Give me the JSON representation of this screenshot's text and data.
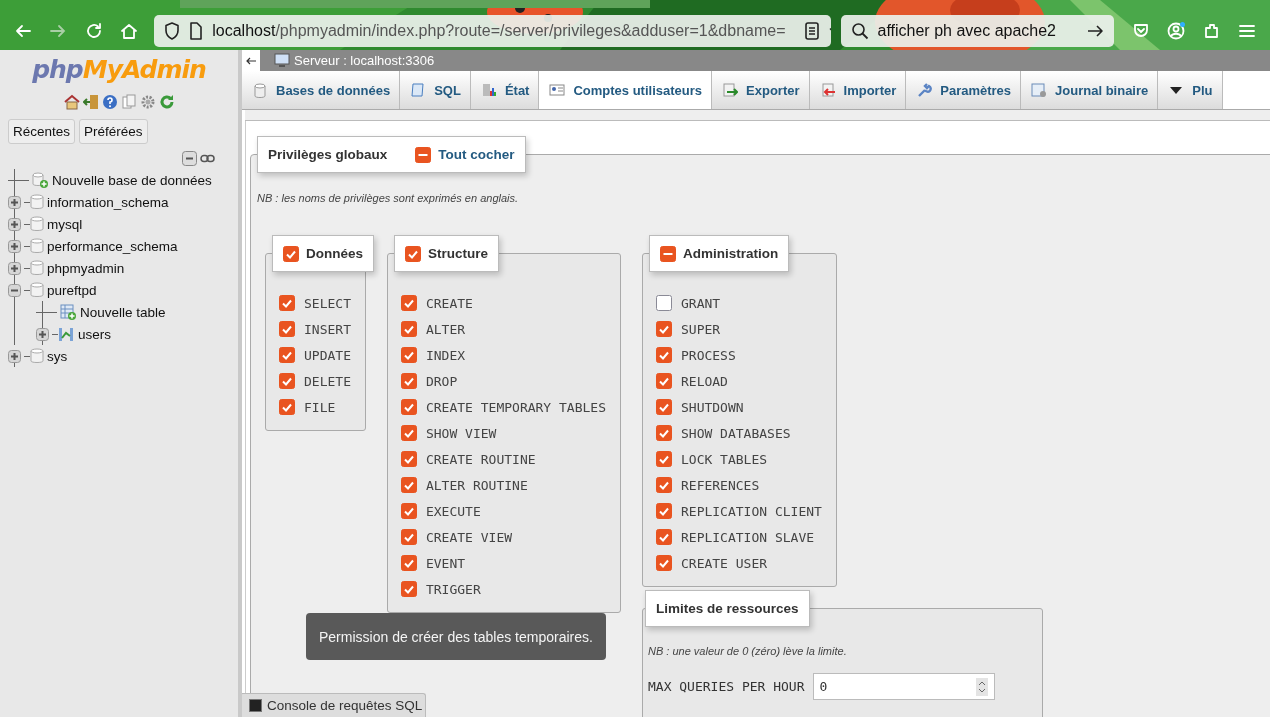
{
  "browser": {
    "url_host": "localhost",
    "url_path": "/phpmyadmin/index.php?route=/server/privileges&adduser=1&dbname=",
    "search": "afficher ph avec apache2"
  },
  "navigation": {
    "logo_php": "php",
    "logo_myadmin": "MyAdmin",
    "tabs": [
      {
        "label": "Récentes"
      },
      {
        "label": "Préférées"
      }
    ],
    "tree": [
      {
        "label": "Nouvelle base de données",
        "kind": "new-db"
      },
      {
        "label": "information_schema",
        "kind": "db",
        "expanded": false
      },
      {
        "label": "mysql",
        "kind": "db",
        "expanded": false
      },
      {
        "label": "performance_schema",
        "kind": "db",
        "expanded": false
      },
      {
        "label": "phpmyadmin",
        "kind": "db",
        "expanded": false
      },
      {
        "label": "pureftpd",
        "kind": "db",
        "expanded": true,
        "children": [
          {
            "label": "Nouvelle table",
            "kind": "new-table"
          },
          {
            "label": "users",
            "kind": "table",
            "expanded": false
          }
        ]
      },
      {
        "label": "sys",
        "kind": "db",
        "expanded": false
      }
    ]
  },
  "breadcrumb": "Serveur : localhost:3306",
  "tabs": [
    {
      "label": "Bases de données",
      "selected": false
    },
    {
      "label": "SQL",
      "selected": false
    },
    {
      "label": "État",
      "selected": false
    },
    {
      "label": "Comptes utilisateurs",
      "selected": true
    },
    {
      "label": "Exporter",
      "selected": false
    },
    {
      "label": "Importer",
      "selected": false
    },
    {
      "label": "Paramètres",
      "selected": false
    },
    {
      "label": "Journal binaire",
      "selected": false
    },
    {
      "label": "Plu",
      "selected": false
    }
  ],
  "global_privileges": {
    "title": "Privilèges globaux",
    "toggle_all": "Tout cocher",
    "toggle_indeterminate": true,
    "note": "NB : les noms de privilèges sont exprimés en anglais.",
    "groups": [
      {
        "title": "Données",
        "checked": true,
        "indeterminate": false,
        "items": [
          {
            "label": "SELECT",
            "checked": true
          },
          {
            "label": "INSERT",
            "checked": true
          },
          {
            "label": "UPDATE",
            "checked": true
          },
          {
            "label": "DELETE",
            "checked": true
          },
          {
            "label": "FILE",
            "checked": true
          }
        ]
      },
      {
        "title": "Structure",
        "checked": true,
        "indeterminate": false,
        "items": [
          {
            "label": "CREATE",
            "checked": true
          },
          {
            "label": "ALTER",
            "checked": true
          },
          {
            "label": "INDEX",
            "checked": true
          },
          {
            "label": "DROP",
            "checked": true
          },
          {
            "label": "CREATE TEMPORARY TABLES",
            "checked": true
          },
          {
            "label": "SHOW VIEW",
            "checked": true
          },
          {
            "label": "CREATE ROUTINE",
            "checked": true
          },
          {
            "label": "ALTER ROUTINE",
            "checked": true
          },
          {
            "label": "EXECUTE",
            "checked": true
          },
          {
            "label": "CREATE VIEW",
            "checked": true
          },
          {
            "label": "EVENT",
            "checked": true
          },
          {
            "label": "TRIGGER",
            "checked": true
          }
        ]
      },
      {
        "title": "Administration",
        "indeterminate": true,
        "items": [
          {
            "label": "GRANT",
            "checked": false
          },
          {
            "label": "SUPER",
            "checked": true
          },
          {
            "label": "PROCESS",
            "checked": true
          },
          {
            "label": "RELOAD",
            "checked": true
          },
          {
            "label": "SHUTDOWN",
            "checked": true
          },
          {
            "label": "SHOW DATABASES",
            "checked": true
          },
          {
            "label": "LOCK TABLES",
            "checked": true
          },
          {
            "label": "REFERENCES",
            "checked": true
          },
          {
            "label": "REPLICATION CLIENT",
            "checked": true
          },
          {
            "label": "REPLICATION SLAVE",
            "checked": true
          },
          {
            "label": "CREATE USER",
            "checked": true
          }
        ]
      }
    ]
  },
  "tooltip": "Permission de créer des tables temporaires.",
  "resource_limits": {
    "title": "Limites de ressources",
    "note": "NB : une valeur de 0 (zéro) lève la limite.",
    "fields": [
      {
        "label": "MAX QUERIES PER HOUR",
        "value": "0"
      }
    ]
  },
  "console": "Console de requêtes SQL"
}
